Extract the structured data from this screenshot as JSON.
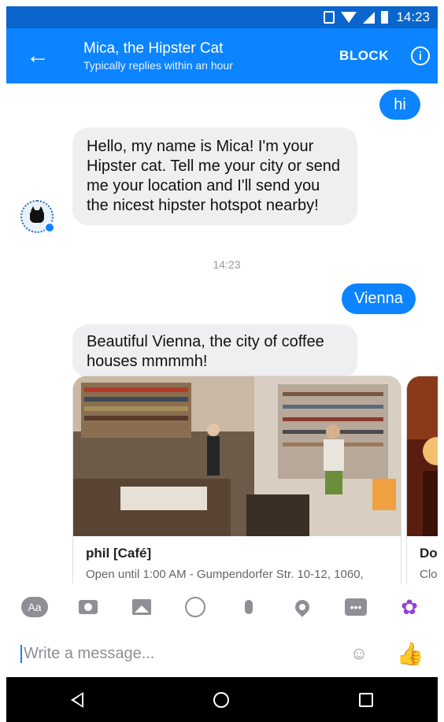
{
  "status_bar": {
    "time": "14:23"
  },
  "header": {
    "title": "Mica, the Hipster Cat",
    "subtitle": "Typically replies within an hour",
    "block_label": "BLOCK",
    "info_icon": "info-icon",
    "back_icon": "arrow-left-icon"
  },
  "messages": [
    {
      "from": "me",
      "text": "hi"
    },
    {
      "from": "bot",
      "text": "Hello, my name is Mica! I'm your Hipster cat. Tell me your city or send me your location and I'll send you the nicest hipster hotspot nearby!"
    },
    {
      "type": "timestamp",
      "text": "14:23"
    },
    {
      "from": "me",
      "text": "Vienna"
    },
    {
      "from": "bot",
      "text": "Beautiful Vienna, the city of coffee houses mmmmh!"
    }
  ],
  "cards": [
    {
      "title": "phil [Café]",
      "subtitle": "Open until 1:00 AM - Gumpendorfer Str. 10-12, 1060,"
    },
    {
      "title": "Don",
      "subtitle": "Clos"
    }
  ],
  "toolbar": {
    "aa_label": "Aa",
    "more_label": "•••",
    "icons": [
      "text-format-icon",
      "camera-icon",
      "image-icon",
      "emoji-icon",
      "microphone-icon",
      "location-icon",
      "more-icon",
      "flower-icon"
    ]
  },
  "composer": {
    "placeholder": "Write a message...",
    "value": ""
  },
  "colors": {
    "accent": "#0c84ff",
    "status_bar": "#0a66cc",
    "bubble_in": "#efeff1",
    "flower": "#8e44d8"
  }
}
